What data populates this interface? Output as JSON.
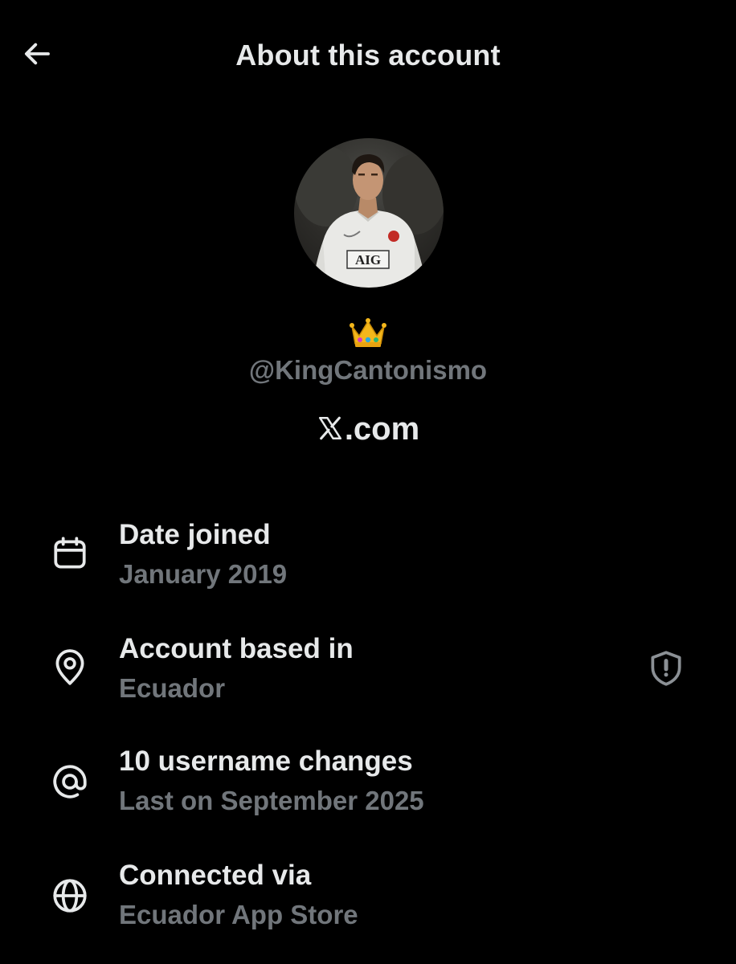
{
  "header": {
    "title": "About this account",
    "back_icon": "arrow-left-icon"
  },
  "profile": {
    "avatar_icon": "profile-photo",
    "display_name_emoji": "👑",
    "handle": "@KingCantonismo",
    "site_logo": "x-logo-icon",
    "site_suffix": ".com"
  },
  "details": [
    {
      "icon": "calendar-icon",
      "label": "Date joined",
      "value": "January 2019"
    },
    {
      "icon": "location-pin-icon",
      "label": "Account based in",
      "value": "Ecuador",
      "trailing_icon": "shield-exclamation-icon"
    },
    {
      "icon": "at-sign-icon",
      "label": "10 username changes",
      "value": "Last on September 2025"
    },
    {
      "icon": "globe-icon",
      "label": "Connected via",
      "value": "Ecuador App Store"
    }
  ],
  "colors": {
    "background": "#000000",
    "primary_text": "#e7e9ea",
    "secondary_text": "#71767b"
  }
}
